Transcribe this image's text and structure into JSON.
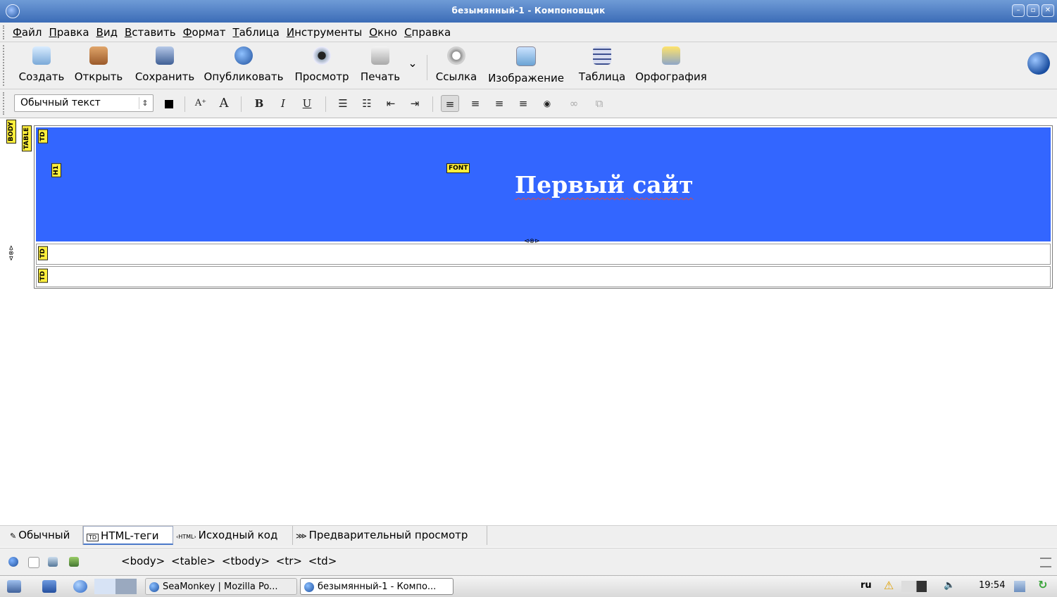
{
  "window": {
    "title": "безымянный-1 - Компоновщик",
    "controls": {
      "minimize": "–",
      "maximize": "▫",
      "close": "✕"
    }
  },
  "menu": [
    "Файл",
    "Правка",
    "Вид",
    "Вставить",
    "Формат",
    "Таблица",
    "Инструменты",
    "Окно",
    "Справка"
  ],
  "toolbar": {
    "create": "Создать",
    "open": "Открыть",
    "save": "Сохранить",
    "publish": "Опубликовать",
    "preview": "Просмотр",
    "print": "Печать",
    "print_menu": "⌄",
    "link": "Ссылка",
    "image": "Изображение",
    "table": "Таблица",
    "spelling": "Орфография"
  },
  "format": {
    "paragraph_style": "Обычный текст",
    "larger": "A⁺",
    "smaller": "A",
    "bold": "B",
    "italic": "I",
    "underline": "U",
    "bullets": "☰",
    "numbers": "☷",
    "outdent": "⇤",
    "indent": "⇥",
    "align_left": "≡",
    "align_center": "≡",
    "align_right": "≡",
    "justify": "≡",
    "anchor": "◉",
    "remove_link": "∞",
    "remove_anchor": "⧉"
  },
  "editor": {
    "tags": {
      "body": "BODY",
      "table": "TABLE",
      "td": "TD",
      "h1": "H1",
      "font": "FONT"
    },
    "heading": "Первый сайт",
    "resize_marker": "⊲⊗⊳"
  },
  "view_tabs": [
    {
      "icon": "✎",
      "label": "Обычный"
    },
    {
      "icon": "TD",
      "label": "HTML-теги"
    },
    {
      "icon": "‹HTML›",
      "label": "Исходный код"
    },
    {
      "icon": "⋙",
      "label": "Предварительный просмотр"
    }
  ],
  "status": {
    "tag_path": "<body> <table> <tbody> <tr> <td>"
  },
  "taskbar": {
    "tasks": [
      "SeaMonkey | Mozilla Po...",
      "безымянный-1 - Компо..."
    ],
    "lang": "ru",
    "time": "19:54"
  },
  "colors": {
    "header_bg": "#3366ff",
    "title_bar": "#4a7cc4",
    "tag_flag": "#ffef3c"
  }
}
